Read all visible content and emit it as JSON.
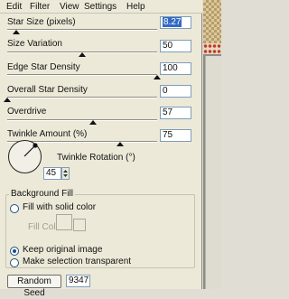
{
  "menu": [
    "Edit",
    "Filter",
    "View",
    "Settings",
    "Help"
  ],
  "sliders": [
    {
      "label": "Star Size (pixels)",
      "value": "8.27",
      "level": 0.06
    },
    {
      "label": "Size Variation",
      "value": "50",
      "level": 0.5
    },
    {
      "label": "Edge Star Density",
      "value": "100",
      "level": 1.0
    },
    {
      "label": "Overall Star Density",
      "value": "0",
      "level": 0.0
    },
    {
      "label": "Overdrive",
      "value": "57",
      "level": 0.57
    },
    {
      "label": "Twinkle Amount (%)",
      "value": "75",
      "level": 0.75
    }
  ],
  "rotation": {
    "label": "Twinkle Rotation (°)",
    "value": "45"
  },
  "background_fill": {
    "title": "Background Fill",
    "fill_solid_label": "Fill with solid color",
    "fill_color_label": "Fill Color",
    "keep_original_label": "Keep original image",
    "make_transparent_label": "Make selection transparent",
    "selected": "keep_original"
  },
  "random_seed": {
    "label": "Random Seed",
    "value": "9347"
  },
  "colors": {
    "selection": "#316ac5",
    "radio_border": "#1c5180"
  }
}
